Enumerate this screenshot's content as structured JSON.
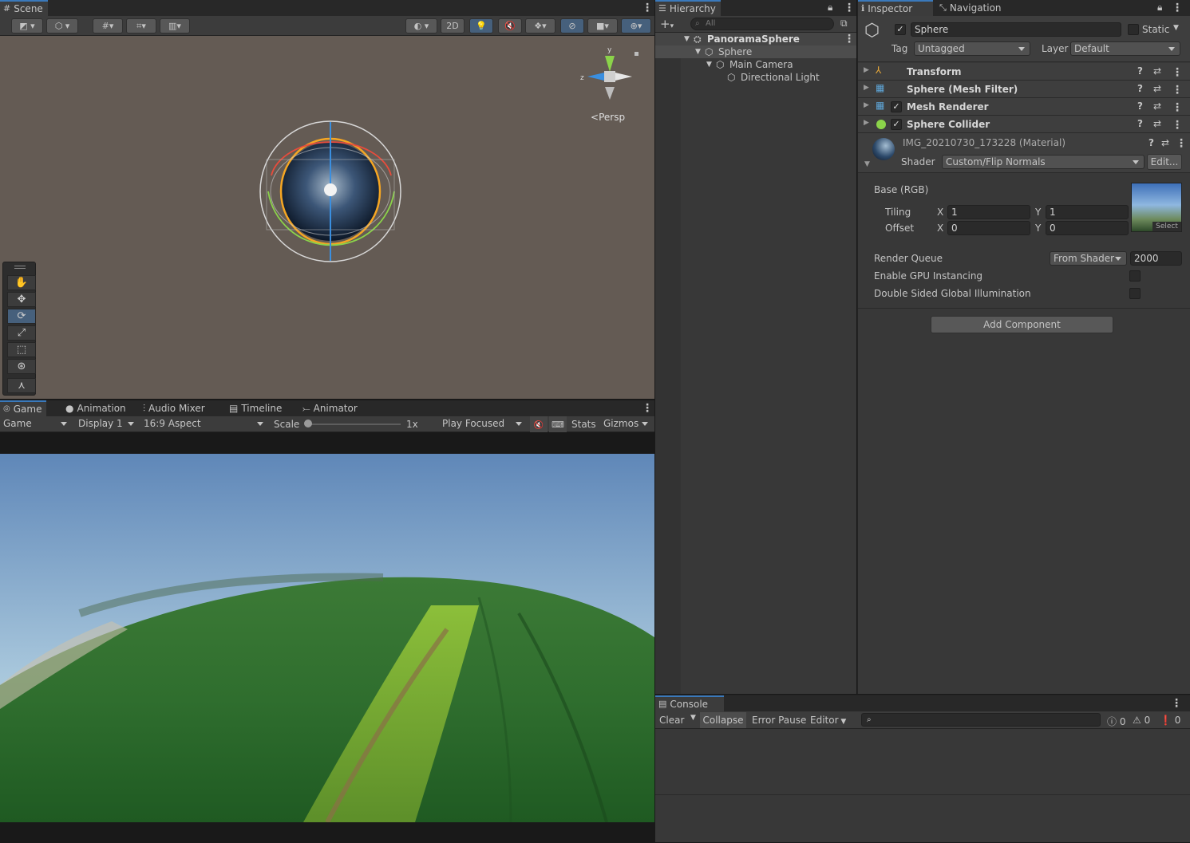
{
  "scene": {
    "tab_label": "Scene",
    "btn_2d": "2D",
    "persp_label": "Persp",
    "gizmo_axes": {
      "y": "y",
      "z": "z"
    },
    "tools": [
      "hand-icon",
      "move-icon",
      "rotate-icon",
      "scale-icon",
      "rect-icon",
      "transform-icon",
      "custom-tool-icon"
    ],
    "active_tool": "rotate-icon"
  },
  "game": {
    "tabs": [
      "Game",
      "Animation",
      "Audio Mixer",
      "Timeline",
      "Animator"
    ],
    "view_select": "Game",
    "display_select": "Display 1",
    "aspect_select": "16:9 Aspect",
    "scale_label": "Scale",
    "scale_value": "1x",
    "scale_level": 0.0,
    "play_mode": "Play Focused",
    "stats_label": "Stats",
    "gizmos_label": "Gizmos"
  },
  "hierarchy": {
    "tab_label": "Hierarchy",
    "search_placeholder": "All",
    "items": [
      {
        "label": "PanoramaSphere",
        "depth": 0,
        "icon": "prefab-icon"
      },
      {
        "label": "Sphere",
        "depth": 1,
        "icon": "gameobject-icon"
      },
      {
        "label": "Main Camera",
        "depth": 2,
        "icon": "gameobject-icon"
      },
      {
        "label": "Directional Light",
        "depth": 3,
        "icon": "gameobject-icon"
      }
    ]
  },
  "inspector": {
    "tab_label": "Inspector",
    "nav_tab_label": "Navigation",
    "object_name": "Sphere",
    "static_label": "Static",
    "tag_label": "Tag",
    "tag_value": "Untagged",
    "layer_label": "Layer",
    "layer_value": "Default",
    "components": [
      {
        "label": "Transform",
        "icon": "transform-icon"
      },
      {
        "label": "Sphere (Mesh Filter)",
        "icon": "mesh-filter-icon"
      },
      {
        "label": "Mesh Renderer",
        "icon": "mesh-renderer-icon"
      },
      {
        "label": "Sphere Collider",
        "icon": "sphere-collider-icon"
      }
    ],
    "material": {
      "name": "IMG_20210730_173228 (Material)",
      "shader_label": "Shader",
      "shader_value": "Custom/Flip Normals",
      "edit_label": "Edit...",
      "base_label": "Base (RGB)",
      "tiling_label": "Tiling",
      "offset_label": "Offset",
      "x_label": "X",
      "y_label": "Y",
      "tiling_x": "1",
      "tiling_y": "1",
      "offset_x": "0",
      "offset_y": "0",
      "select_label": "Select",
      "render_queue_label": "Render Queue",
      "render_queue_mode": "From Shader",
      "render_queue_value": "2000",
      "gpu_instancing_label": "Enable GPU Instancing",
      "double_sided_label": "Double Sided Global Illumination"
    },
    "add_component_label": "Add Component"
  },
  "console": {
    "tab_label": "Console",
    "clear_label": "Clear",
    "collapse_label": "Collapse",
    "error_pause_label": "Error Pause",
    "editor_label": "Editor",
    "info_count": "0",
    "warn_count": "0",
    "error_count": "0"
  },
  "colors": {
    "accent": "#3a79bb",
    "panel": "#383838",
    "scene_bg": "#645b54",
    "header": "#282828"
  }
}
